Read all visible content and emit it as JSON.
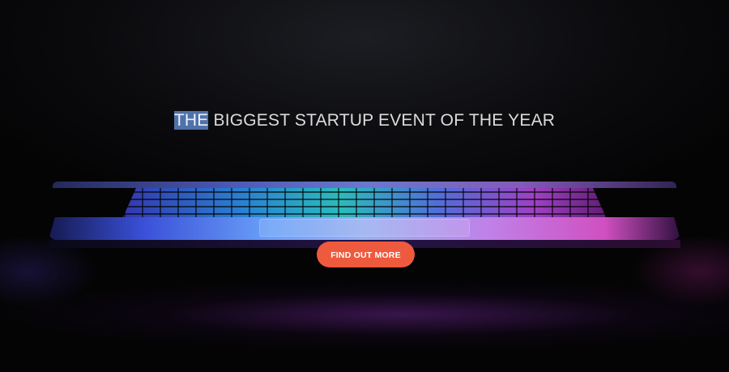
{
  "hero": {
    "headline_highlight": "THE",
    "headline_rest": " BIGGEST STARTUP EVENT OF THE YEAR",
    "cta_label": "FIND OUT MORE"
  },
  "colors": {
    "cta": "#ee5a3d",
    "selection": "#4e73a8",
    "background": "#050507"
  }
}
